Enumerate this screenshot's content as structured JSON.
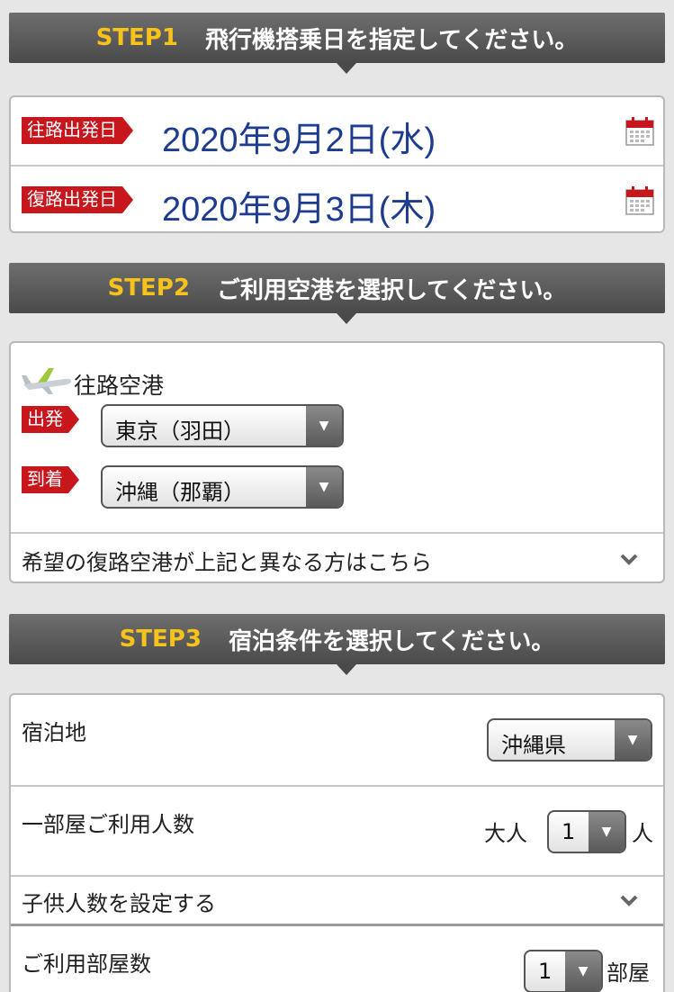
{
  "step1": {
    "num": "STEP1",
    "title": "飛行機搭乗日を指定してください。",
    "outbound": {
      "tag": "往路出発日",
      "date": "2020年9月2日(水)"
    },
    "return": {
      "tag": "復路出発日",
      "date": "2020年9月3日(木)"
    }
  },
  "step2": {
    "num": "STEP2",
    "title": "ご利用空港を選択してください。",
    "section_label": "往路空港",
    "departure": {
      "tag": "出発",
      "value": "東京（羽田）"
    },
    "arrival": {
      "tag": "到着",
      "value": "沖縄（那覇）"
    },
    "return_airport_link": "希望の復路空港が上記と異なる方はこちら"
  },
  "step3": {
    "num": "STEP3",
    "title": "宿泊条件を選択してください。",
    "stay": {
      "label": "宿泊地",
      "value": "沖縄県"
    },
    "guests": {
      "label": "一部屋ご利用人数",
      "prefix": "大人",
      "value": "1",
      "suffix": "人"
    },
    "children_link": "子供人数を設定する",
    "rooms": {
      "label": "ご利用部屋数",
      "value": "1",
      "suffix": "部屋"
    }
  },
  "colors": {
    "accent_red": "#c8161d",
    "step_yellow": "#f7c21a",
    "date_blue": "#1d3b8f",
    "header_gray": "#5a5a5a"
  }
}
